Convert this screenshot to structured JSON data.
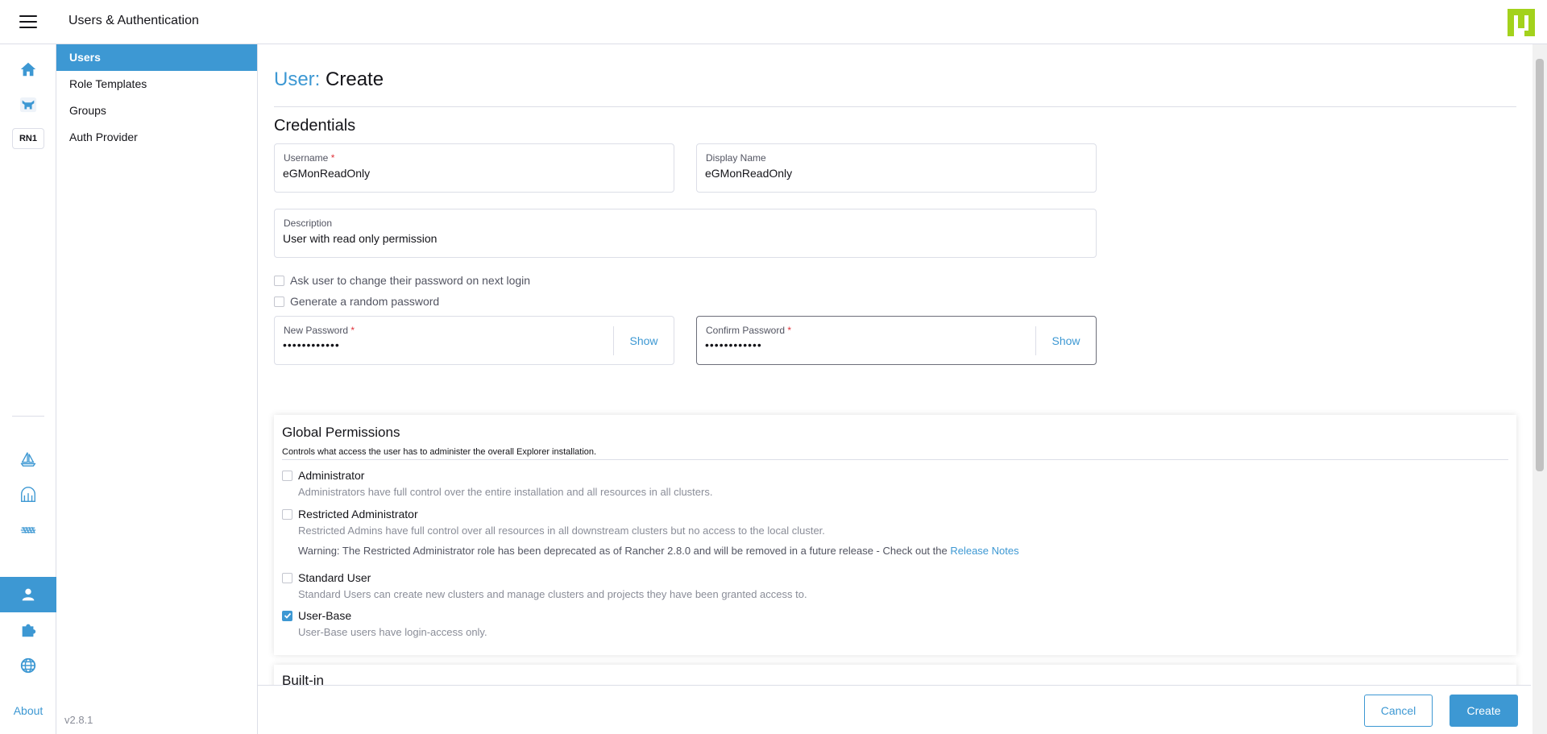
{
  "header": {
    "title": "Users & Authentication"
  },
  "rail": {
    "cluster_badge": "RN1",
    "about": "About"
  },
  "subnav": {
    "items": [
      {
        "label": "Users",
        "active": true
      },
      {
        "label": "Role Templates",
        "active": false
      },
      {
        "label": "Groups",
        "active": false
      },
      {
        "label": "Auth Provider",
        "active": false
      }
    ],
    "version": "v2.8.1"
  },
  "page": {
    "crumb": "User:",
    "action": "Create",
    "section": "Credentials"
  },
  "form": {
    "username": {
      "label": "Username",
      "required": "*",
      "value": "eGMonReadOnly"
    },
    "display_name": {
      "label": "Display Name",
      "value": "eGMonReadOnly"
    },
    "description": {
      "label": "Description",
      "value": "User with read only permission"
    },
    "ask_change_password": {
      "label": "Ask user to change their password on next login",
      "checked": false
    },
    "random_password": {
      "label": "Generate a random password",
      "checked": false
    },
    "new_password": {
      "label": "New Password",
      "required": "*",
      "value": "••••••••••••",
      "show": "Show"
    },
    "confirm_password": {
      "label": "Confirm Password",
      "required": "*",
      "value": "••••••••••••",
      "show": "Show"
    }
  },
  "global_permissions": {
    "title": "Global Permissions",
    "subtitle": "Controls what access the user has to administer the overall Explorer installation.",
    "options": [
      {
        "label": "Administrator",
        "checked": false,
        "desc": "Administrators have full control over the entire installation and all resources in all clusters."
      },
      {
        "label": "Restricted Administrator",
        "checked": false,
        "desc": "Restricted Admins have full control over all resources in all downstream clusters but no access to the local cluster.",
        "warning": "Warning: The Restricted Administrator role has been deprecated as of Rancher 2.8.0 and will be removed in a future release - Check out the ",
        "warning_link": "Release Notes"
      },
      {
        "label": "Standard User",
        "checked": false,
        "desc": "Standard Users can create new clusters and manage clusters and projects they have been granted access to."
      },
      {
        "label": "User-Base",
        "checked": true,
        "desc": "User-Base users have login-access only."
      }
    ]
  },
  "builtin": {
    "title": "Built-in"
  },
  "footer": {
    "cancel": "Cancel",
    "create": "Create"
  },
  "colors": {
    "accent": "#3d98d3",
    "logo": "#a3d21c"
  }
}
